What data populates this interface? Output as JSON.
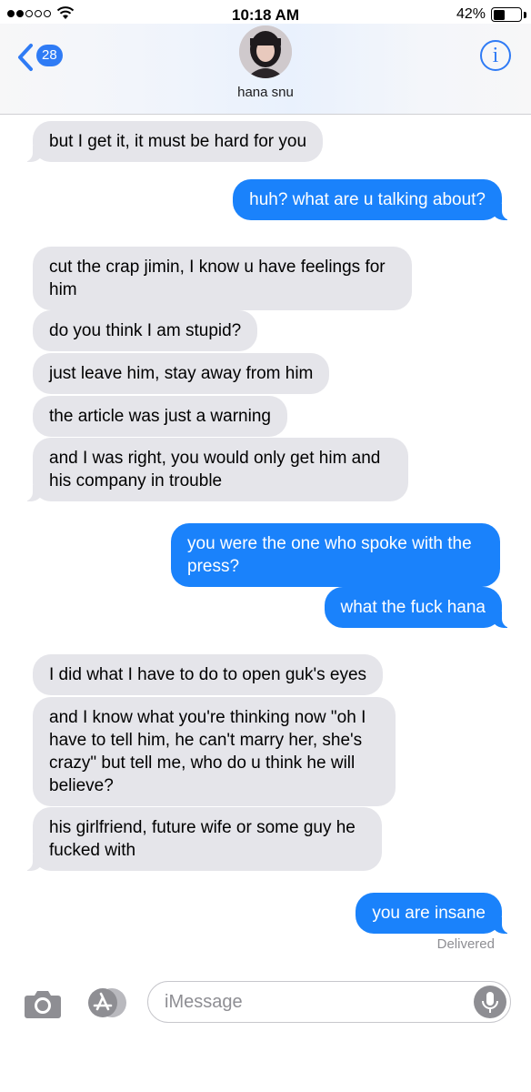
{
  "status_bar": {
    "time": "10:18 AM",
    "battery_percent": "42%",
    "battery_level": 0.42,
    "signal_bars": 2,
    "signal_total": 5
  },
  "header": {
    "back_badge": "28",
    "contact_name": "hana snu",
    "info_glyph": "i"
  },
  "messages": [
    {
      "from": "them",
      "text": "but I get it, it must be hard for you"
    },
    {
      "from": "me",
      "text": "huh? what are u talking about?"
    },
    {
      "from": "them",
      "text": "cut the crap jimin, I know u have feelings for him"
    },
    {
      "from": "them",
      "text": "do you think I am stupid?"
    },
    {
      "from": "them",
      "text": "just leave him, stay away from him"
    },
    {
      "from": "them",
      "text": "the article was just a warning"
    },
    {
      "from": "them",
      "text": "and I was right, you would only get him and his company in trouble"
    },
    {
      "from": "me",
      "text": "you were the one who spoke with the press?"
    },
    {
      "from": "me",
      "text": "what the fuck hana"
    },
    {
      "from": "them",
      "text": "I did what I have to do to open guk's eyes"
    },
    {
      "from": "them",
      "text": "and I know what you're thinking now \"oh I have to tell him, he can't marry her, she's crazy\" but tell me, who do u think he will believe?"
    },
    {
      "from": "them",
      "text": "his girlfriend, future wife or some guy he fucked with"
    },
    {
      "from": "me",
      "text": "you are insane"
    }
  ],
  "delivered_label": "Delivered",
  "input": {
    "placeholder": "iMessage",
    "value": ""
  },
  "icons": {
    "back": "chevron-left-icon",
    "info": "info-icon",
    "camera": "camera-icon",
    "apps": "app-store-icon",
    "mic": "microphone-icon",
    "wifi": "wifi-icon",
    "battery": "battery-icon"
  },
  "colors": {
    "accent": "#1a82fb",
    "incoming_bubble": "#e5e5ea",
    "badge": "#2f7bf5"
  }
}
